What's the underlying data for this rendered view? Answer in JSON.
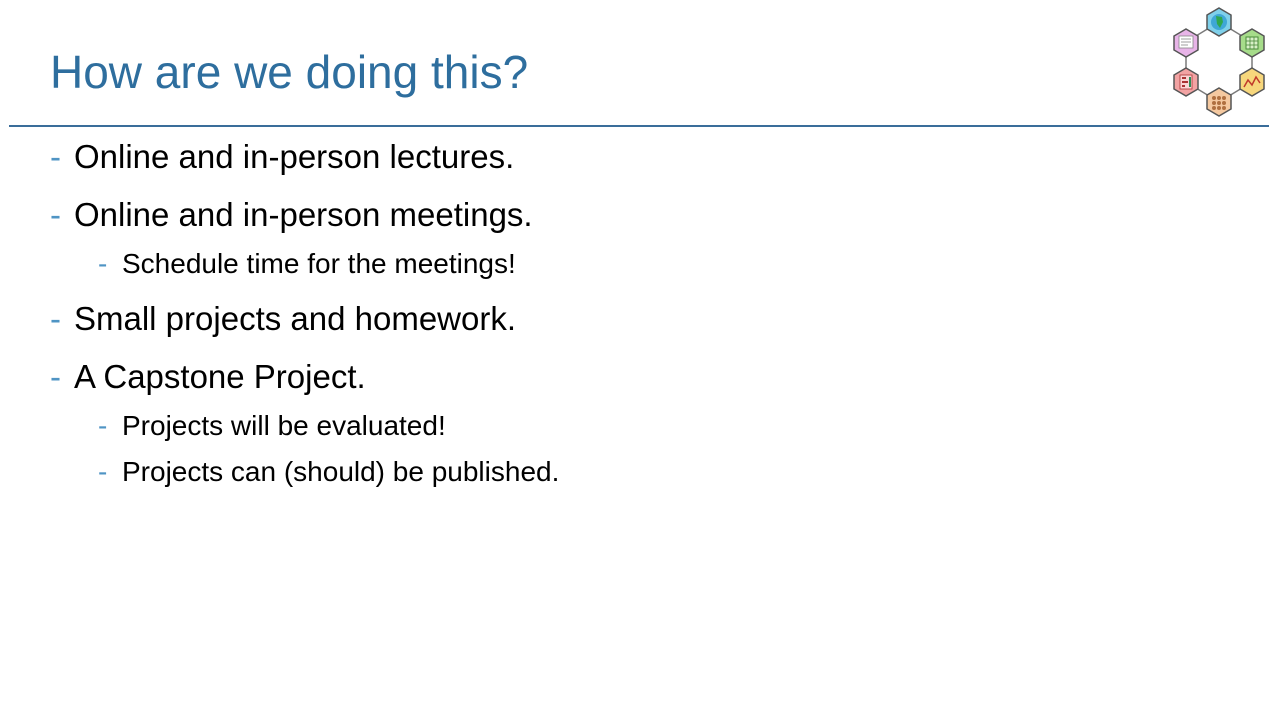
{
  "slide": {
    "title": "How are we doing this?",
    "bullet_marker": "-",
    "bullets": [
      {
        "text": "Online and in-person lectures.",
        "sub": []
      },
      {
        "text": "Online and in-person meetings.",
        "sub": [
          {
            "text": "Schedule time for the meetings!"
          }
        ]
      },
      {
        "text": "Small projects and homework.",
        "sub": []
      },
      {
        "text": "A Capstone Project.",
        "sub": [
          {
            "text": "Projects will be evaluated!"
          },
          {
            "text": "Projects can (should) be published."
          }
        ]
      }
    ]
  },
  "colors": {
    "title": "#2e6e9e",
    "rule": "#3a6d9a",
    "bullet_marker": "#4f94c4",
    "body_text": "#000000"
  },
  "logo": {
    "icon": "hexagon-cluster-logo",
    "hexagons": [
      "globe-icon",
      "grid-table-icon",
      "line-chart-icon",
      "nodes-grid-icon",
      "bar-table-icon",
      "document-icon"
    ]
  }
}
